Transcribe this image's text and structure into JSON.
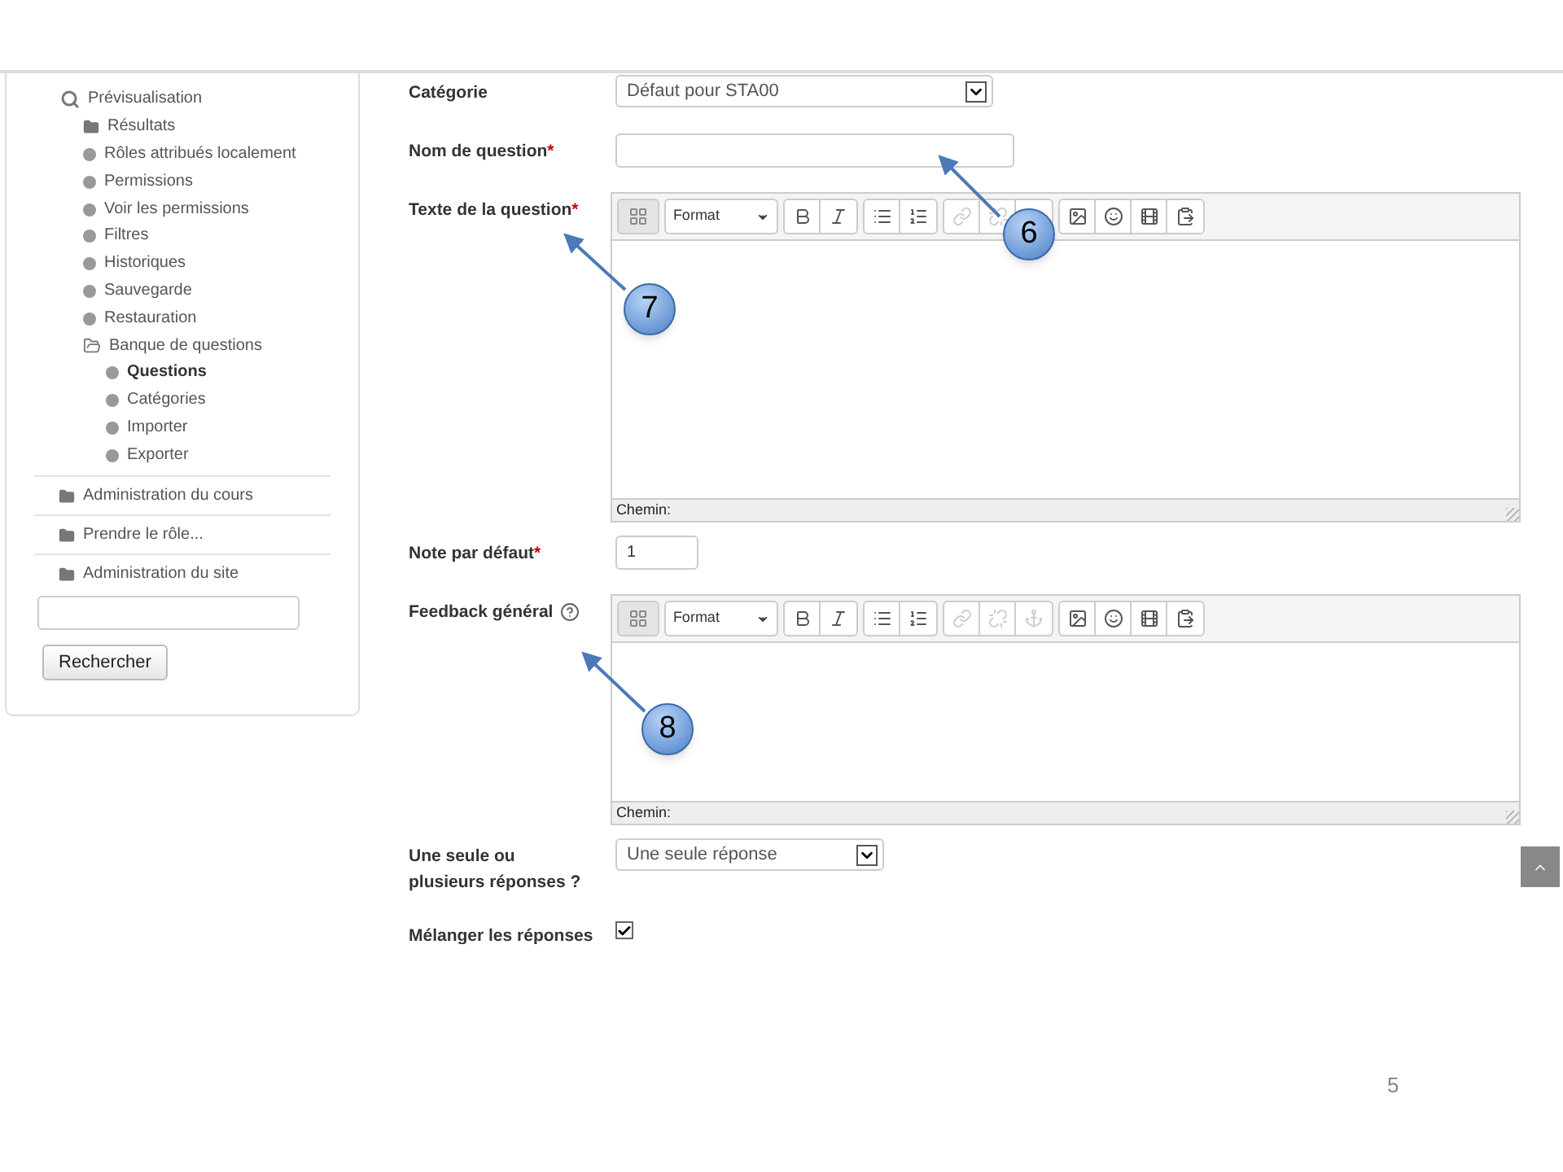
{
  "sidebar": {
    "tree": [
      {
        "label": "Prévisualisation",
        "kind": "search",
        "selected": false,
        "children": [
          {
            "label": "Résultats",
            "kind": "folder",
            "selected": false
          },
          {
            "label": "Rôles attribués localement",
            "kind": "leaf",
            "selected": false
          },
          {
            "label": "Permissions",
            "kind": "leaf",
            "selected": false
          },
          {
            "label": "Voir les permissions",
            "kind": "leaf",
            "selected": false
          },
          {
            "label": "Filtres",
            "kind": "leaf",
            "selected": false
          },
          {
            "label": "Historiques",
            "kind": "leaf",
            "selected": false
          },
          {
            "label": "Sauvegarde",
            "kind": "leaf",
            "selected": false
          },
          {
            "label": "Restauration",
            "kind": "leaf",
            "selected": false
          },
          {
            "label": "Banque de questions",
            "kind": "folder-open",
            "selected": false,
            "children": [
              {
                "label": "Questions",
                "kind": "leaf",
                "selected": true
              },
              {
                "label": "Catégories",
                "kind": "leaf",
                "selected": false
              },
              {
                "label": "Importer",
                "kind": "leaf",
                "selected": false
              },
              {
                "label": "Exporter",
                "kind": "leaf",
                "selected": false
              }
            ]
          }
        ]
      }
    ],
    "sections": [
      "Administration du cours",
      "Prendre le rôle...",
      "Administration du site"
    ],
    "search_button": "Rechercher"
  },
  "form": [
    {
      "kind": "select",
      "label": "Catégorie",
      "value": "Défaut pour STA00"
    },
    {
      "kind": "text",
      "label": "Nom de question",
      "required_mark": "*"
    },
    {
      "kind": "editor",
      "label": "Texte de la question",
      "required_mark": "*",
      "path_label": "Chemin:",
      "format": "Format"
    },
    {
      "kind": "number",
      "label": "Note par défaut",
      "required_mark": "*",
      "value": "1"
    },
    {
      "kind": "editor-short",
      "label": "Feedback général",
      "help": true,
      "path_label": "Chemin:",
      "format": "Format"
    },
    {
      "kind": "select-wide",
      "label": "Une seule ou plusieurs réponses ?",
      "value": "Une seule réponse"
    },
    {
      "kind": "checkbox",
      "label": "Mélanger les réponses",
      "checked": true
    }
  ],
  "callouts": [
    "6",
    "7",
    "8"
  ],
  "page_number": "5"
}
